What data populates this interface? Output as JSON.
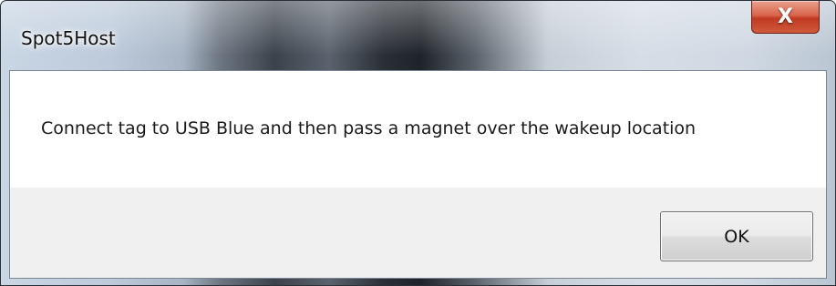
{
  "window": {
    "title": "Spot5Host",
    "close_glyph": "X",
    "close_icon": "close-icon"
  },
  "message": {
    "text": "Connect tag to USB Blue and then pass a magnet over the wakeup location"
  },
  "buttons": {
    "ok_label": "OK"
  },
  "colors": {
    "close_button": "#c7452a",
    "client_background": "#f0f0f0",
    "message_background": "#ffffff"
  }
}
